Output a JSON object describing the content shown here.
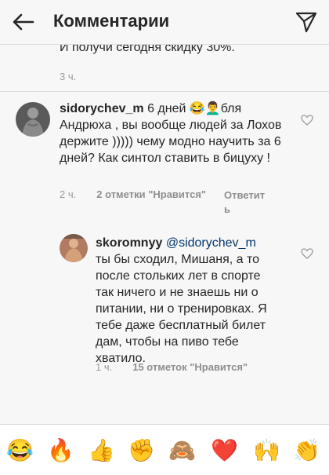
{
  "header": {
    "title": "Комментарии"
  },
  "caption": {
    "cut_text": "...",
    "text": "И получи сегодня скидку 30%.",
    "time": "3 ч."
  },
  "comments": [
    {
      "username": "sidorychev_m",
      "text_start": "6 дней 😂👨‍🦱бля Андрюха , вы вообще людей за Лохов держите ))))) чему модно научить за 6 дней? Как синтол ставить в бицуху !",
      "time": "2 ч.",
      "likes": "2 отметки \"Нравится\"",
      "reply": "Ответить"
    },
    {
      "username": "skoromnyy",
      "mention": "@sidorychev_m",
      "text": "ты бы сходил, Мишаня, а то после стольких лет в спорте так ничего и не знаешь ни о питании, ни о тренировках. Я тебе даже бесплатный билет дам, чтобы на пиво тебе хватило.",
      "time": "1 ч.",
      "likes": "15 отметок \"Нравится\""
    }
  ],
  "emoji_bar": [
    "😂",
    "🔥",
    "👍",
    "✊",
    "🙈",
    "❤️",
    "🙌",
    "👏"
  ]
}
